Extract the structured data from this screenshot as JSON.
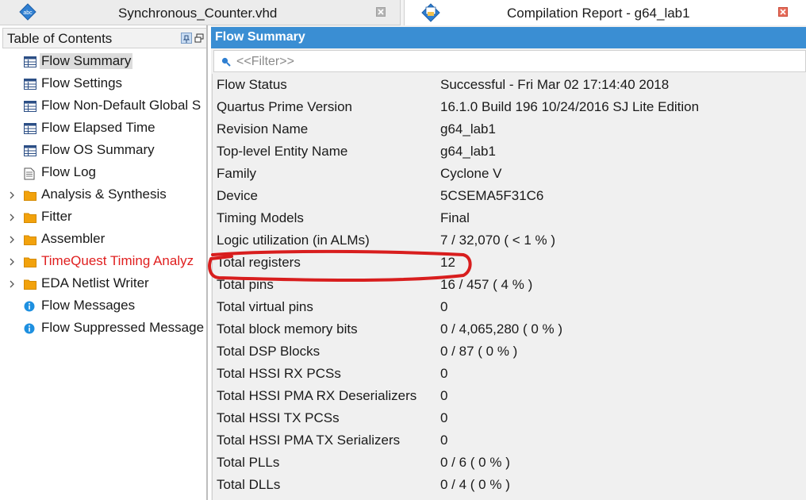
{
  "tabs": [
    {
      "title": "Synchronous_Counter.vhd",
      "icon": "vhdl-file-icon",
      "active": false
    },
    {
      "title": "Compilation Report - g64_lab1",
      "icon": "compilation-report-icon",
      "active": true
    }
  ],
  "toc": {
    "title": "Table of Contents",
    "items": [
      {
        "label": "Flow Summary",
        "icon": "table-icon",
        "selected": true
      },
      {
        "label": "Flow Settings",
        "icon": "table-icon"
      },
      {
        "label": "Flow Non-Default Global S",
        "icon": "table-icon"
      },
      {
        "label": "Flow Elapsed Time",
        "icon": "table-icon"
      },
      {
        "label": "Flow OS Summary",
        "icon": "table-icon"
      },
      {
        "label": "Flow Log",
        "icon": "document-icon"
      },
      {
        "label": "Analysis & Synthesis",
        "icon": "folder-icon",
        "expandable": true
      },
      {
        "label": "Fitter",
        "icon": "folder-icon",
        "expandable": true
      },
      {
        "label": "Assembler",
        "icon": "folder-icon",
        "expandable": true
      },
      {
        "label": "TimeQuest Timing Analyz",
        "icon": "folder-icon",
        "expandable": true,
        "color": "#e02020"
      },
      {
        "label": "EDA Netlist Writer",
        "icon": "folder-icon",
        "expandable": true
      },
      {
        "label": "Flow Messages",
        "icon": "info-icon"
      },
      {
        "label": "Flow Suppressed Message",
        "icon": "info-icon"
      }
    ]
  },
  "panel": {
    "title": "Flow Summary",
    "filter_placeholder": "<<Filter>>"
  },
  "summary_rows": [
    {
      "key": "Flow Status",
      "value": "Successful - Fri Mar 02 17:14:40 2018"
    },
    {
      "key": "Quartus Prime Version",
      "value": "16.1.0 Build 196 10/24/2016 SJ Lite Edition"
    },
    {
      "key": "Revision Name",
      "value": "g64_lab1"
    },
    {
      "key": "Top-level Entity Name",
      "value": "g64_lab1"
    },
    {
      "key": "Family",
      "value": "Cyclone V"
    },
    {
      "key": "Device",
      "value": "5CSEMA5F31C6"
    },
    {
      "key": "Timing Models",
      "value": "Final"
    },
    {
      "key": "Logic utilization (in ALMs)",
      "value": "7 / 32,070 ( < 1 % )"
    },
    {
      "key": "Total registers",
      "value": "12",
      "highlighted": true
    },
    {
      "key": "Total pins",
      "value": "16 / 457 ( 4 % )"
    },
    {
      "key": "Total virtual pins",
      "value": "0"
    },
    {
      "key": "Total block memory bits",
      "value": "0 / 4,065,280 ( 0 % )"
    },
    {
      "key": "Total DSP Blocks",
      "value": "0 / 87 ( 0 % )"
    },
    {
      "key": "Total HSSI RX PCSs",
      "value": "0"
    },
    {
      "key": "Total HSSI PMA RX Deserializers",
      "value": "0"
    },
    {
      "key": "Total HSSI TX PCSs",
      "value": "0"
    },
    {
      "key": "Total HSSI PMA TX Serializers",
      "value": "0"
    },
    {
      "key": "Total PLLs",
      "value": "0 / 6 ( 0 % )"
    },
    {
      "key": "Total DLLs",
      "value": "0 / 4 ( 0 % )"
    }
  ],
  "colors": {
    "title_bar": "#3a8ed3",
    "annotation": "#d81e1e",
    "folder": "#f2a20c",
    "info": "#1e90e0"
  }
}
